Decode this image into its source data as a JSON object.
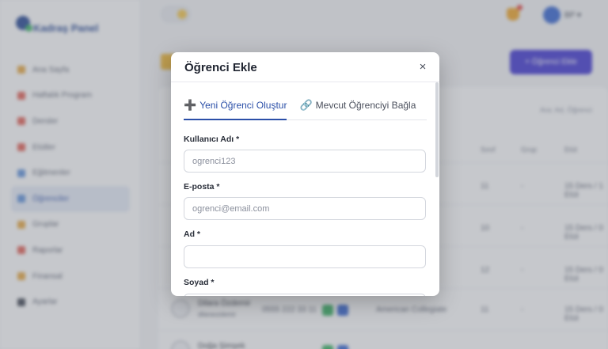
{
  "sidebar": {
    "logo_text": "Kadraş Panel",
    "items": [
      {
        "label": "Ana Sayfa",
        "color": "#e8a53a"
      },
      {
        "label": "Haftalık Program",
        "color": "#e25b4f"
      },
      {
        "label": "Dersler",
        "color": "#e25b4f"
      },
      {
        "label": "Etütler",
        "color": "#e25b4f"
      },
      {
        "label": "Eğitmenler",
        "color": "#5b8fd9"
      },
      {
        "label": "Öğrenciler",
        "color": "#5b8fd9"
      },
      {
        "label": "Gruplar",
        "color": "#e8a53a"
      },
      {
        "label": "Raporlar",
        "color": "#e25b4f"
      },
      {
        "label": "Finansal",
        "color": "#e8a53a"
      },
      {
        "label": "Ayarlar",
        "color": "#3a3f4c"
      }
    ]
  },
  "topbar": {
    "user_name": "BP ▾"
  },
  "main": {
    "primary_button": "+ Öğrenci Ekle",
    "search_hint": "Ara: Ad, Öğrenci",
    "columns": [
      "Sınıf",
      "Grup",
      "Etüt"
    ],
    "rows": [
      {
        "name": "",
        "phone": "",
        "class": "11",
        "group": "-",
        "etut": "15 Ders / 1 Etüt"
      },
      {
        "name": "",
        "phone": "",
        "class": "10",
        "group": "-",
        "etut": "15 Ders / 0 Etüt"
      },
      {
        "name": "",
        "phone": "",
        "class": "12",
        "group": "-",
        "etut": "15 Ders / 0 Etüt"
      },
      {
        "name": "Dilara Özdemir",
        "sub": "dilaraozdemir",
        "phone": "0555 222 33 11",
        "school": "American Collegiate",
        "class": "11",
        "group": "-",
        "etut": "15 Ders / 0 Etüt"
      },
      {
        "name": "Doğa Şimşek",
        "sub": "",
        "phone": "",
        "class": "",
        "group": "",
        "etut": ""
      }
    ]
  },
  "modal": {
    "title": "Öğrenci Ekle",
    "close_icon": "×",
    "tabs": [
      {
        "icon": "plus-icon",
        "glyph": "➕",
        "label": "Yeni Öğrenci Oluştur",
        "active": true
      },
      {
        "icon": "link-icon",
        "glyph": "🔗",
        "label": "Mevcut Öğrenciyi Bağla",
        "active": false
      }
    ],
    "fields": {
      "username": {
        "label": "Kullanıcı Adı *",
        "placeholder": "ogrenci123",
        "value": ""
      },
      "email": {
        "label": "E-posta *",
        "placeholder": "ogrenci@email.com",
        "value": ""
      },
      "first_name": {
        "label": "Ad *",
        "placeholder": "",
        "value": ""
      },
      "last_name": {
        "label": "Soyad *",
        "placeholder": "",
        "value": ""
      }
    }
  },
  "colors": {
    "accent": "#2b4fa8",
    "primary_button": "#3a2fd0",
    "backdrop": "rgba(120,124,134,0.42)"
  }
}
